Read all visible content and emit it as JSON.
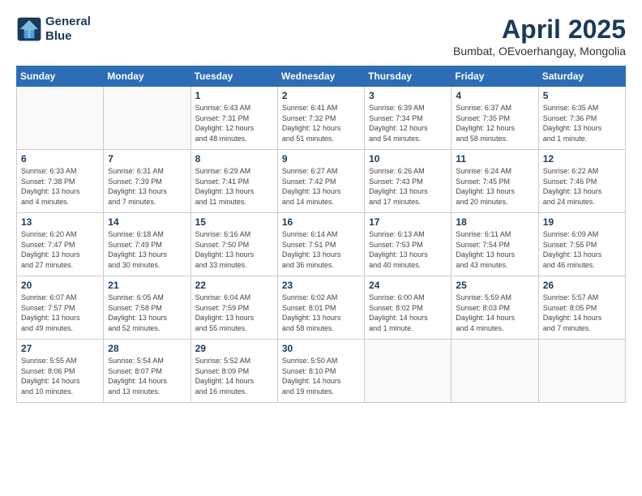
{
  "header": {
    "logo_line1": "General",
    "logo_line2": "Blue",
    "month_title": "April 2025",
    "location": "Bumbat, OEvoerhangay, Mongolia"
  },
  "weekdays": [
    "Sunday",
    "Monday",
    "Tuesday",
    "Wednesday",
    "Thursday",
    "Friday",
    "Saturday"
  ],
  "weeks": [
    [
      {
        "day": "",
        "info": ""
      },
      {
        "day": "",
        "info": ""
      },
      {
        "day": "1",
        "info": "Sunrise: 6:43 AM\nSunset: 7:31 PM\nDaylight: 12 hours\nand 48 minutes."
      },
      {
        "day": "2",
        "info": "Sunrise: 6:41 AM\nSunset: 7:32 PM\nDaylight: 12 hours\nand 51 minutes."
      },
      {
        "day": "3",
        "info": "Sunrise: 6:39 AM\nSunset: 7:34 PM\nDaylight: 12 hours\nand 54 minutes."
      },
      {
        "day": "4",
        "info": "Sunrise: 6:37 AM\nSunset: 7:35 PM\nDaylight: 12 hours\nand 58 minutes."
      },
      {
        "day": "5",
        "info": "Sunrise: 6:35 AM\nSunset: 7:36 PM\nDaylight: 13 hours\nand 1 minute."
      }
    ],
    [
      {
        "day": "6",
        "info": "Sunrise: 6:33 AM\nSunset: 7:38 PM\nDaylight: 13 hours\nand 4 minutes."
      },
      {
        "day": "7",
        "info": "Sunrise: 6:31 AM\nSunset: 7:39 PM\nDaylight: 13 hours\nand 7 minutes."
      },
      {
        "day": "8",
        "info": "Sunrise: 6:29 AM\nSunset: 7:41 PM\nDaylight: 13 hours\nand 11 minutes."
      },
      {
        "day": "9",
        "info": "Sunrise: 6:27 AM\nSunset: 7:42 PM\nDaylight: 13 hours\nand 14 minutes."
      },
      {
        "day": "10",
        "info": "Sunrise: 6:26 AM\nSunset: 7:43 PM\nDaylight: 13 hours\nand 17 minutes."
      },
      {
        "day": "11",
        "info": "Sunrise: 6:24 AM\nSunset: 7:45 PM\nDaylight: 13 hours\nand 20 minutes."
      },
      {
        "day": "12",
        "info": "Sunrise: 6:22 AM\nSunset: 7:46 PM\nDaylight: 13 hours\nand 24 minutes."
      }
    ],
    [
      {
        "day": "13",
        "info": "Sunrise: 6:20 AM\nSunset: 7:47 PM\nDaylight: 13 hours\nand 27 minutes."
      },
      {
        "day": "14",
        "info": "Sunrise: 6:18 AM\nSunset: 7:49 PM\nDaylight: 13 hours\nand 30 minutes."
      },
      {
        "day": "15",
        "info": "Sunrise: 6:16 AM\nSunset: 7:50 PM\nDaylight: 13 hours\nand 33 minutes."
      },
      {
        "day": "16",
        "info": "Sunrise: 6:14 AM\nSunset: 7:51 PM\nDaylight: 13 hours\nand 36 minutes."
      },
      {
        "day": "17",
        "info": "Sunrise: 6:13 AM\nSunset: 7:53 PM\nDaylight: 13 hours\nand 40 minutes."
      },
      {
        "day": "18",
        "info": "Sunrise: 6:11 AM\nSunset: 7:54 PM\nDaylight: 13 hours\nand 43 minutes."
      },
      {
        "day": "19",
        "info": "Sunrise: 6:09 AM\nSunset: 7:55 PM\nDaylight: 13 hours\nand 46 minutes."
      }
    ],
    [
      {
        "day": "20",
        "info": "Sunrise: 6:07 AM\nSunset: 7:57 PM\nDaylight: 13 hours\nand 49 minutes."
      },
      {
        "day": "21",
        "info": "Sunrise: 6:05 AM\nSunset: 7:58 PM\nDaylight: 13 hours\nand 52 minutes."
      },
      {
        "day": "22",
        "info": "Sunrise: 6:04 AM\nSunset: 7:59 PM\nDaylight: 13 hours\nand 55 minutes."
      },
      {
        "day": "23",
        "info": "Sunrise: 6:02 AM\nSunset: 8:01 PM\nDaylight: 13 hours\nand 58 minutes."
      },
      {
        "day": "24",
        "info": "Sunrise: 6:00 AM\nSunset: 8:02 PM\nDaylight: 14 hours\nand 1 minute."
      },
      {
        "day": "25",
        "info": "Sunrise: 5:59 AM\nSunset: 8:03 PM\nDaylight: 14 hours\nand 4 minutes."
      },
      {
        "day": "26",
        "info": "Sunrise: 5:57 AM\nSunset: 8:05 PM\nDaylight: 14 hours\nand 7 minutes."
      }
    ],
    [
      {
        "day": "27",
        "info": "Sunrise: 5:55 AM\nSunset: 8:06 PM\nDaylight: 14 hours\nand 10 minutes."
      },
      {
        "day": "28",
        "info": "Sunrise: 5:54 AM\nSunset: 8:07 PM\nDaylight: 14 hours\nand 13 minutes."
      },
      {
        "day": "29",
        "info": "Sunrise: 5:52 AM\nSunset: 8:09 PM\nDaylight: 14 hours\nand 16 minutes."
      },
      {
        "day": "30",
        "info": "Sunrise: 5:50 AM\nSunset: 8:10 PM\nDaylight: 14 hours\nand 19 minutes."
      },
      {
        "day": "",
        "info": ""
      },
      {
        "day": "",
        "info": ""
      },
      {
        "day": "",
        "info": ""
      }
    ]
  ]
}
